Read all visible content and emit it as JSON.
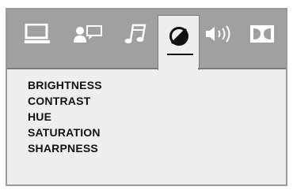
{
  "tabs": [
    {
      "icon": "monitor-icon",
      "active": false
    },
    {
      "icon": "user-speech-icon",
      "active": false
    },
    {
      "icon": "music-note-icon",
      "active": false
    },
    {
      "icon": "video-adjust-icon",
      "active": true
    },
    {
      "icon": "speaker-icon",
      "active": false
    },
    {
      "icon": "dolby-icon",
      "active": false
    }
  ],
  "menu": {
    "items": [
      {
        "label": "BRIGHTNESS"
      },
      {
        "label": "CONTRAST"
      },
      {
        "label": "HUE"
      },
      {
        "label": "SATURATION"
      },
      {
        "label": "SHARPNESS"
      }
    ]
  },
  "colors": {
    "tab_bar": "#a0a0a0",
    "panel": "#eeeeee",
    "icon_light": "#ffffff",
    "icon_dark": "#111111",
    "border": "#9a9a9a"
  }
}
